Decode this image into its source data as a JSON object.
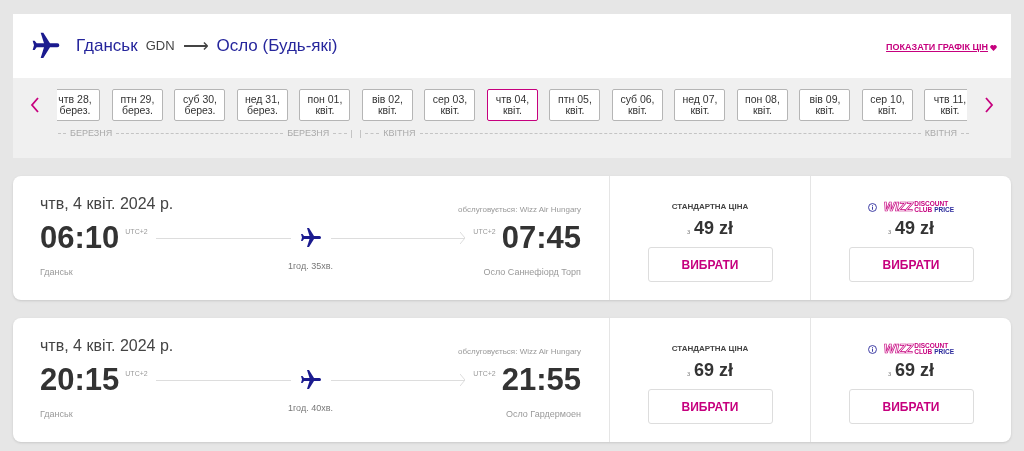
{
  "route": {
    "origin": "Гданськ",
    "origin_code": "GDN",
    "arrow": "⟶",
    "destination": "Осло (Будь-які)",
    "price_chart_link": "ПОКАЗАТИ ГРАФІК ЦІН"
  },
  "date_strip": {
    "dates": [
      {
        "day": "чтв 28,",
        "month": "берез.",
        "selected": false
      },
      {
        "day": "птн 29,",
        "month": "берез.",
        "selected": false
      },
      {
        "day": "суб 30,",
        "month": "берез.",
        "selected": false
      },
      {
        "day": "нед 31,",
        "month": "берез.",
        "selected": false
      },
      {
        "day": "пон 01,",
        "month": "квіт.",
        "selected": false
      },
      {
        "day": "вів 02,",
        "month": "квіт.",
        "selected": false
      },
      {
        "day": "сер 03,",
        "month": "квіт.",
        "selected": false
      },
      {
        "day": "чтв 04,",
        "month": "квіт.",
        "selected": true
      },
      {
        "day": "птн 05,",
        "month": "квіт.",
        "selected": false
      },
      {
        "day": "суб 06,",
        "month": "квіт.",
        "selected": false
      },
      {
        "day": "нед 07,",
        "month": "квіт.",
        "selected": false
      },
      {
        "day": "пон 08,",
        "month": "квіт.",
        "selected": false
      },
      {
        "day": "вів 09,",
        "month": "квіт.",
        "selected": false
      },
      {
        "day": "сер 10,",
        "month": "квіт.",
        "selected": false
      },
      {
        "day": "чтв 11,",
        "month": "квіт.",
        "selected": false
      }
    ],
    "month_labels": [
      "БЕРЕЗНЯ",
      "БЕРЕЗНЯ",
      "КВІТНЯ",
      "КВІТНЯ"
    ]
  },
  "flights": [
    {
      "date": "чтв, 4 квіт. 2024 р.",
      "operator": "обслуговується: Wizz Air Hungary",
      "departure_time": "06:10",
      "departure_tz": "UTC+2",
      "arrival_time": "07:45",
      "arrival_tz": "UTC+2",
      "origin": "Гданськ",
      "duration": "1год. 35хв.",
      "destination": "Осло Саннефіорд Торп",
      "standard": {
        "label": "СТАНДАРТНА ЦІНА",
        "from": "з",
        "price": "49 zł",
        "button": "ВИБРАТИ"
      },
      "club": {
        "brand": "WIZZ",
        "line1": "DISCOUNT",
        "line2a": "CLUB",
        "line2b": "PRICE",
        "from": "з",
        "price": "49 zł",
        "button": "ВИБРАТИ"
      }
    },
    {
      "date": "чтв, 4 квіт. 2024 р.",
      "operator": "обслуговується: Wizz Air Hungary",
      "departure_time": "20:15",
      "departure_tz": "UTC+2",
      "arrival_time": "21:55",
      "arrival_tz": "UTC+2",
      "origin": "Гданськ",
      "duration": "1год. 40хв.",
      "destination": "Осло Гардермоен",
      "standard": {
        "label": "СТАНДАРТНА ЦІНА",
        "from": "з",
        "price": "69 zł",
        "button": "ВИБРАТИ"
      },
      "club": {
        "brand": "WIZZ",
        "line1": "DISCOUNT",
        "line2a": "CLUB",
        "line2b": "PRICE",
        "from": "з",
        "price": "69 zł",
        "button": "ВИБРАТИ"
      }
    }
  ]
}
